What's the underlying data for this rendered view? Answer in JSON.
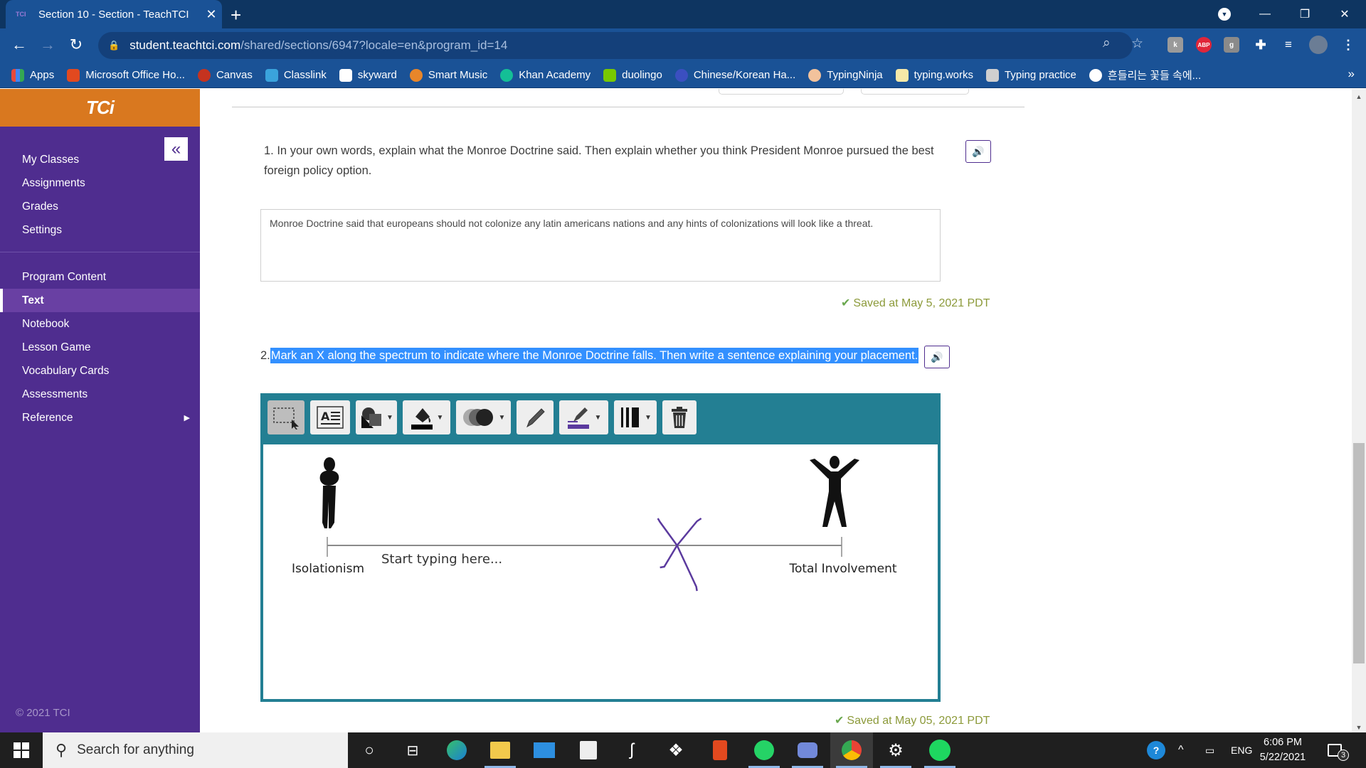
{
  "browser": {
    "tab_title": "Section 10 - Section - TeachTCI",
    "tab_close": "✕",
    "new_tab": "+",
    "url_host": "student.teachtci.com",
    "url_path": "/shared/sections/6947?locale=en&program_id=14",
    "window_controls": {
      "minimize": "—",
      "restore": "❐",
      "close": "✕"
    },
    "extensions": [
      "k",
      "ABP",
      "g"
    ],
    "bookmarks": [
      {
        "label": "Apps",
        "color": "#e84a3c"
      },
      {
        "label": "Microsoft Office Ho...",
        "color": "#e2491f"
      },
      {
        "label": "Canvas",
        "color": "#c5331f"
      },
      {
        "label": "Classlink",
        "color": "#3aa3dc"
      },
      {
        "label": "skyward",
        "color": "#ffffff"
      },
      {
        "label": "Smart Music",
        "color": "#e8862a"
      },
      {
        "label": "Khan Academy",
        "color": "#14bf96"
      },
      {
        "label": "duolingo",
        "color": "#78c800"
      },
      {
        "label": "Chinese/Korean Ha...",
        "color": "#3b4fc0"
      },
      {
        "label": "TypingNinja",
        "color": "#f2c29c"
      },
      {
        "label": "typing.works",
        "color": "#f6e9a8"
      },
      {
        "label": "Typing practice",
        "color": "#cfcfcf"
      },
      {
        "label": "흔들리는 꽃들 속에...",
        "color": "#ffffff"
      }
    ],
    "bookmarks_more": "»"
  },
  "sidebar": {
    "brand": "TCi",
    "collapse": "«",
    "group1": [
      "My Classes",
      "Assignments",
      "Grades",
      "Settings"
    ],
    "group2": [
      "Program Content",
      "Text",
      "Notebook",
      "Lesson Game",
      "Vocabulary Cards",
      "Assessments",
      "Reference"
    ],
    "active_item": "Text",
    "copyright": "© 2021 TCI"
  },
  "questions": {
    "q1": {
      "text_line1": "1. In your own words, explain what the Monroe Doctrine said. Then explain whether you think President Monroe pursued the best",
      "text_line2": "foreign policy option.",
      "answer": "Monroe Doctrine said that europeans should not colonize any latin americans nations and any hints of colonizations will look like a threat.",
      "saved": "Saved at May 5, 2021 PDT"
    },
    "q2": {
      "number": "2.",
      "text": "Mark an X along the spectrum to indicate where the Monroe Doctrine falls. Then write a sentence explaining your placement.",
      "saved": "Saved at May 05, 2021 PDT",
      "tools": [
        "select-tool",
        "text-tool",
        "shapes-tool",
        "fill-color-tool",
        "opacity-tool",
        "pen-tool",
        "stroke-color-tool",
        "stroke-width-tool",
        "delete-tool"
      ],
      "canvas": {
        "left_label": "Isolationism",
        "right_label": "Total Involvement",
        "placeholder": "Start typing here...",
        "x_mark_position_percent": 68,
        "x_mark_color": "#5b3a9e"
      }
    }
  },
  "taskbar": {
    "search_placeholder": "Search for anything",
    "tray_lang": "ENG",
    "time": "6:06 PM",
    "date": "5/22/2021",
    "notifications": "3"
  }
}
